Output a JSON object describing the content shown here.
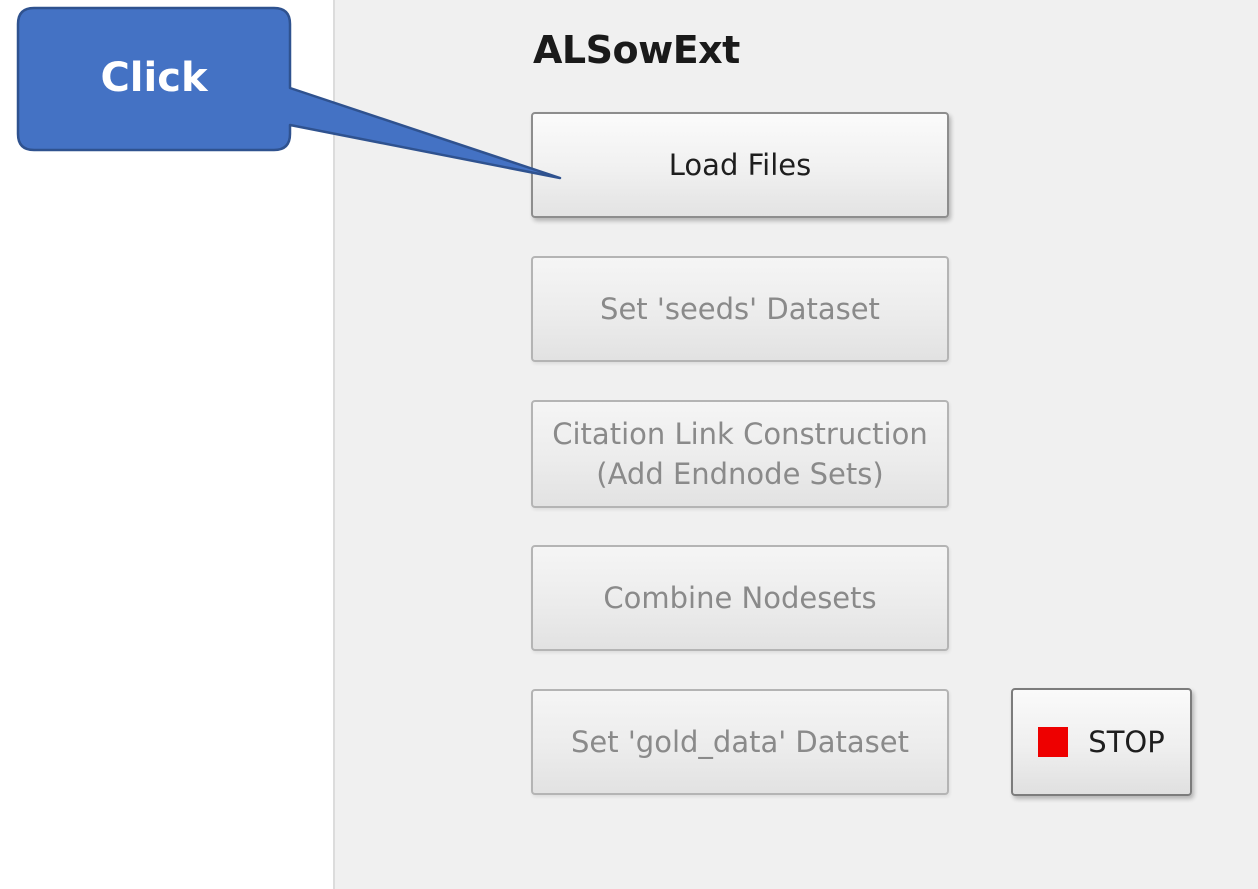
{
  "panel": {
    "title": "ALSowExt"
  },
  "buttons": {
    "load_files": "Load Files",
    "set_seeds": "Set 'seeds' Dataset",
    "citation_link": "Citation Link Construction\n(Add Endnode Sets)",
    "combine_nodesets": "Combine Nodesets",
    "set_gold_data": "Set 'gold_data' Dataset",
    "stop": "STOP"
  },
  "button_states": {
    "load_files": "enabled",
    "set_seeds": "disabled",
    "citation_link": "disabled",
    "combine_nodesets": "disabled",
    "set_gold_data": "disabled",
    "stop": "enabled"
  },
  "callout": {
    "text": "Click",
    "fill_color": "#4472c4",
    "border_color": "#2f528f"
  },
  "colors": {
    "stop_icon": "#ee0000",
    "panel_bg": "#f0f0f0",
    "disabled_text": "#8a8a8a",
    "enabled_text": "#1e1e1e"
  }
}
